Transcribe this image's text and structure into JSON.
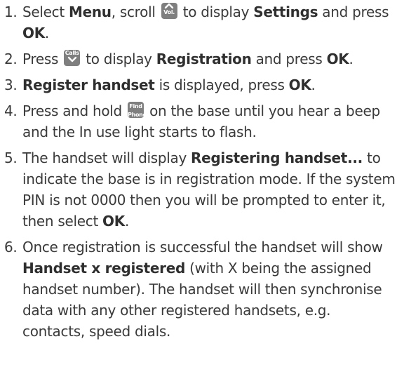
{
  "steps": [
    {
      "num": "1.",
      "t1": "Select ",
      "b1": "Menu",
      "t2": ", scroll ",
      "key": {
        "label": "Vol.",
        "icon": "chevron-up-icon"
      },
      "t3": " to display ",
      "b2": "Settings",
      "t4": " and press ",
      "b3": "OK",
      "t5": "."
    },
    {
      "num": "2.",
      "t1": "Press ",
      "key": {
        "label": "Calls",
        "icon": "chevron-down-icon"
      },
      "t2": " to display ",
      "b1": "Registration",
      "t3": " and press ",
      "b2": "OK",
      "t4": "."
    },
    {
      "num": "3.",
      "b1": "Register handset",
      "t1": " is displayed, press ",
      "b2": "OK",
      "t2": "."
    },
    {
      "num": "4.",
      "t1": "Press and hold ",
      "key": {
        "line1": "Find",
        "line2": "Phone"
      },
      "t2": " on the base until you hear a beep and the In use light starts to flash."
    },
    {
      "num": "5.",
      "t1": "The handset will display ",
      "b1": "Registering handset...",
      "t2": " to indicate the base is in registration mode. If the system PIN is not 0000 then you will be prompted to enter it, then select ",
      "b2": "OK",
      "t3": "."
    },
    {
      "num": "6.",
      "t1": "Once registration is successful the handset will show ",
      "b1": "Handset x registered",
      "t2": " (with X being the assigned handset number). The handset will then synchronise data with any other registered handsets, e.g. contacts, speed dials."
    }
  ]
}
